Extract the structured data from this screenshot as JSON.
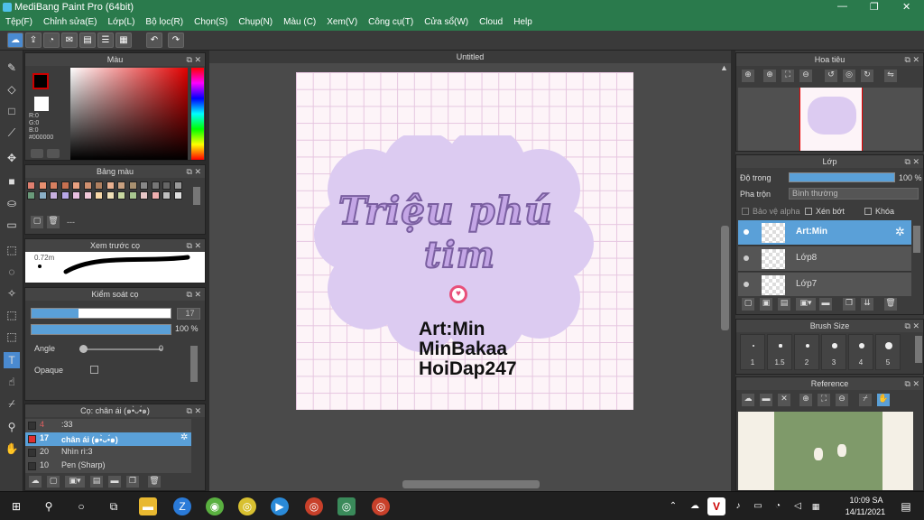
{
  "app": {
    "title": "MediBang Paint Pro (64bit)"
  },
  "menu": [
    "Tệp(F)",
    "Chỉnh sửa(E)",
    "Lớp(L)",
    "Bộ lọc(R)",
    "Chọn(S)",
    "Chụp(N)",
    "Màu (C)",
    "Xem(V)",
    "Công cụ(T)",
    "Cửa sổ(W)",
    "Cloud",
    "Help"
  ],
  "window_controls": {
    "minimize": "—",
    "restore": "❐",
    "close": "✕"
  },
  "color_panel": {
    "title": "Màu",
    "r": "R:0",
    "g": "G:0",
    "b": "B:0",
    "hex": "#000000"
  },
  "palette_panel": {
    "title": "Bảng màu",
    "tail": "---"
  },
  "brush_preview": {
    "title": "Xem trước cọ",
    "size_label": "0.72m"
  },
  "brush_control": {
    "title": "Kiểm soát cọ",
    "size_value": "17",
    "opacity_value": "100 %",
    "angle_label": "Angle",
    "angle_value": "0",
    "opaque_label": "Opaque"
  },
  "brush_list": {
    "title": "Cọ: chân ái (๑•̀ᴗ•́๑)",
    "items": [
      {
        "num": "4",
        "name": ":33",
        "selected": false
      },
      {
        "num": "17",
        "name": "chân ái (๑•̀ᴗ•́๑)",
        "selected": true
      },
      {
        "num": "20",
        "name": "Nhìn rì:3",
        "selected": false
      },
      {
        "num": "10",
        "name": "Pen (Sharp)",
        "selected": false
      }
    ]
  },
  "document": {
    "tab": "Untitled",
    "title_line1": "Triệu phú",
    "title_line2": "tim",
    "credit1": "Art:Min",
    "credit2": "MinBakaa",
    "credit3": "HoiDap247"
  },
  "navigator": {
    "title": "Hoa tiêu"
  },
  "layer_panel": {
    "title": "Lớp",
    "opacity_label": "Độ trong",
    "opacity_value": "100 %",
    "blend_label": "Pha trộn",
    "blend_value": "Bình thường",
    "protect_alpha": "Bảo vệ alpha",
    "clipping": "Xén bớt",
    "lock": "Khóa",
    "layers": [
      {
        "name": "Art:Min",
        "selected": true
      },
      {
        "name": "Lớp8",
        "selected": false
      },
      {
        "name": "Lớp7",
        "selected": false
      }
    ]
  },
  "brush_size": {
    "title": "Brush Size",
    "sizes": [
      "1",
      "1.5",
      "2",
      "3",
      "4",
      "5"
    ]
  },
  "reference": {
    "title": "Reference"
  },
  "taskbar": {
    "time": "10:09 SA",
    "date": "14/11/2021"
  },
  "colors": {
    "accent": "#2a7a4c",
    "selection": "#5aa0d8",
    "cloud": "#dccbf1"
  }
}
